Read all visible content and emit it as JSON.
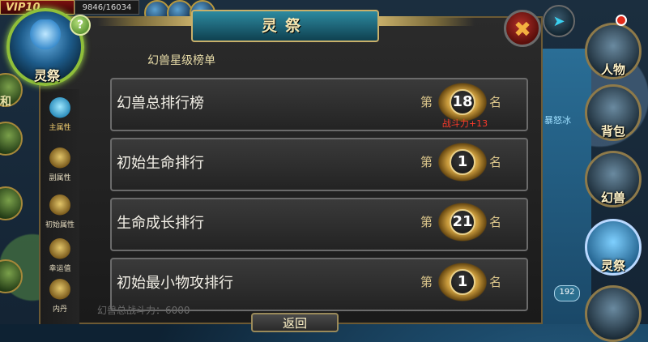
{
  "hud": {
    "vip_label": "VIP10",
    "hp_value": "9846/16034"
  },
  "main_orb": {
    "label": "灵祭"
  },
  "help": {
    "label": "?"
  },
  "left_partial_text": "和",
  "panel": {
    "title": "灵祭",
    "close_glyph": "✖",
    "forward_glyph": "➤"
  },
  "tabs": [
    {
      "label": "主属性",
      "active": true
    },
    {
      "label": "副属性",
      "active": false
    },
    {
      "label": "初始属性",
      "active": false
    },
    {
      "label": "幸运值",
      "active": false
    },
    {
      "label": "内丹",
      "active": false
    }
  ],
  "ranking": {
    "header": "幻兽星级榜单",
    "prefix": "第",
    "suffix": "名",
    "rows": [
      {
        "name": "幻兽总排行榜",
        "rank": "18",
        "bonus": "战斗力+13"
      },
      {
        "name": "初始生命排行",
        "rank": "1",
        "bonus": ""
      },
      {
        "name": "生命成长排行",
        "rank": "21",
        "bonus": ""
      },
      {
        "name": "初始最小物攻排行",
        "rank": "1",
        "bonus": ""
      }
    ]
  },
  "footer": {
    "faded_text": "幻兽总战斗力：6000",
    "return_label": "返回"
  },
  "right_menu": [
    {
      "label": "人物",
      "active": false
    },
    {
      "label": "背包",
      "active": false
    },
    {
      "label": "幻兽",
      "active": false
    },
    {
      "label": "灵祭",
      "active": true
    },
    {
      "label": "",
      "active": false
    }
  ],
  "side_note": "暴怒冰",
  "count_badge": "192",
  "colors": {
    "accent_gold": "#c9b06a",
    "bonus_red": "#ff3a2a",
    "active_tab": "#f4d070"
  }
}
